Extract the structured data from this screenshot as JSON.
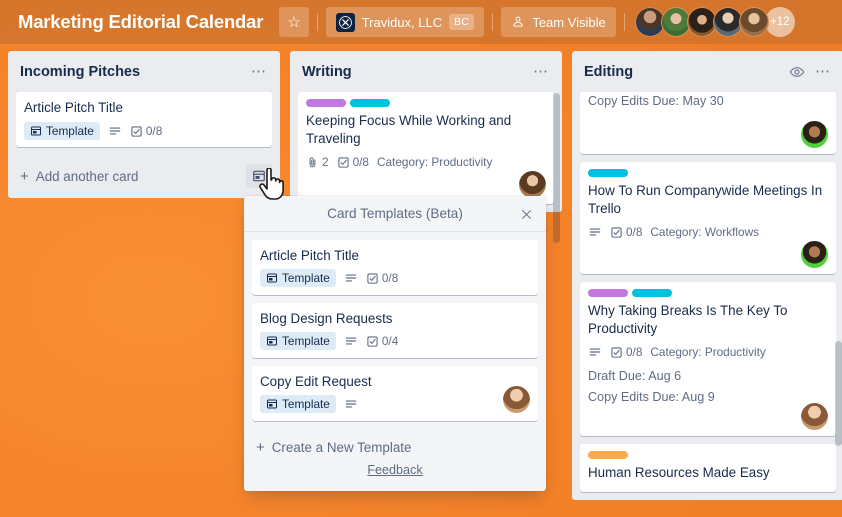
{
  "header": {
    "board_title": "Marketing Editorial Calendar",
    "star_icon": "star-icon",
    "team": {
      "name": "Travidux, LLC",
      "logo_icon": "atlassian-x-icon",
      "initials": "BC"
    },
    "visibility": {
      "icon": "team-people-icon",
      "label": "Team Visible"
    },
    "members": [
      {
        "name": "member-1"
      },
      {
        "name": "member-2"
      },
      {
        "name": "member-3"
      },
      {
        "name": "member-4"
      },
      {
        "name": "member-5"
      }
    ],
    "members_overflow": "+12"
  },
  "colors": {
    "board_background": "#F5862B",
    "header_background": "#C87436",
    "list_background": "#EBECF0",
    "card_background": "#FFFFFF",
    "text_primary": "#172B4D",
    "text_subtle": "#5E6C84",
    "template_badge_background": "#DDEBF7",
    "label_purple": "#C377E0",
    "label_cyan": "#00C2E0",
    "label_orange": "#FFAB4A"
  },
  "lists": [
    {
      "title": "Incoming Pitches",
      "menu_icon": "ellipsis-icon",
      "watch_icon": null,
      "cards": [
        {
          "title": "Article Pitch Title",
          "labels": [],
          "template_badge": "Template",
          "description_icon": "description-icon",
          "checklist": "0/8",
          "attachments": null,
          "category": null,
          "dates": [],
          "avatar": null
        }
      ],
      "add_card": {
        "label": "Add another card",
        "plus_icon": "plus-icon",
        "template_button_icon": "card-template-icon"
      }
    },
    {
      "title": "Writing",
      "menu_icon": "ellipsis-icon",
      "watch_icon": null,
      "cards": [
        {
          "title": "Keeping Focus While Working and Traveling",
          "labels": [
            "#C377E0",
            "#00C2E0"
          ],
          "template_badge": null,
          "description_icon": null,
          "checklist": "0/8",
          "attachments": "2",
          "attachment_icon": "paperclip-icon",
          "category": "Category: Productivity",
          "dates": [],
          "avatar": "member-writing-1"
        }
      ],
      "add_card": null
    },
    {
      "title": "Editing",
      "menu_icon": "ellipsis-icon",
      "watch_icon": "eye-icon",
      "cards": [
        {
          "title": null,
          "clipped": true,
          "labels": [],
          "dates": [
            "Copy Edits Due: May 30"
          ],
          "avatar": "member-editing-1"
        },
        {
          "title": "How To Run Companywide Meetings In Trello",
          "labels": [
            "#00C2E0"
          ],
          "description_icon": "description-icon",
          "checklist": "0/8",
          "category": "Category: Workflows",
          "dates": [],
          "avatar": "member-editing-1"
        },
        {
          "title": "Why Taking Breaks Is The Key To Productivity",
          "labels": [
            "#C377E0",
            "#00C2E0"
          ],
          "description_icon": "description-icon",
          "checklist": "0/8",
          "category": "Category: Productivity",
          "dates": [
            "Draft Due: Aug 6",
            "Copy Edits Due: Aug 9"
          ],
          "avatar": "member-editing-2"
        },
        {
          "title": "Human Resources Made Easy",
          "labels": [
            "#FFAB4A"
          ],
          "description_icon": null,
          "checklist": null,
          "category": null,
          "dates": [],
          "avatar": null
        }
      ],
      "add_card": null
    }
  ],
  "templates_popover": {
    "title": "Card Templates (Beta)",
    "close_icon": "close-icon",
    "templates": [
      {
        "title": "Article Pitch Title",
        "badge": "Template",
        "description_icon": "description-icon",
        "checklist": "0/8",
        "avatar": null
      },
      {
        "title": "Blog Design Requests",
        "badge": "Template",
        "description_icon": "description-icon",
        "checklist": "0/4",
        "avatar": null
      },
      {
        "title": "Copy Edit Request",
        "badge": "Template",
        "description_icon": "description-icon",
        "checklist": null,
        "avatar": "template-owner"
      }
    ],
    "create_label": "Create a New Template",
    "create_icon": "plus-icon",
    "feedback_label": "Feedback"
  },
  "cursor": {
    "icon": "pointing-hand-cursor"
  }
}
